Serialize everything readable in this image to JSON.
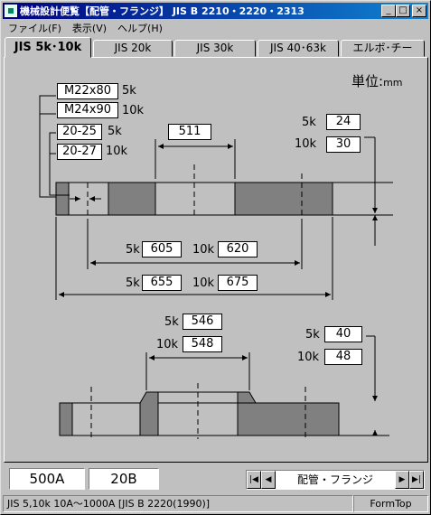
{
  "window": {
    "title": "機械設計便覧【配管・フランジ】 JIS B 2210・2220・2313",
    "min_glyph": "_",
    "max_glyph": "□",
    "close_glyph": "×"
  },
  "menu": [
    "ファイル(F)",
    "表示(V)",
    "ヘルプ(H)"
  ],
  "tabs": [
    {
      "label": "JIS 5k･10k",
      "active": true
    },
    {
      "label": "JIS 20k",
      "active": false
    },
    {
      "label": "JIS 30k",
      "active": false
    },
    {
      "label": "JIS 40･63k",
      "active": false
    },
    {
      "label": "エルボ･チー",
      "active": false
    }
  ],
  "unit": {
    "label": "単位:",
    "value": "mm"
  },
  "top_flange": {
    "bolts": [
      {
        "size": "M22x80",
        "class": "5k"
      },
      {
        "size": "M24x90",
        "class": "10k"
      }
    ],
    "holes": [
      {
        "size": "20-25",
        "class": "5k"
      },
      {
        "size": "20-27",
        "class": "10k"
      }
    ],
    "raised_face": "511",
    "thickness": [
      {
        "class": "5k",
        "value": "24"
      },
      {
        "class": "10k",
        "value": "30"
      }
    ],
    "pcd": [
      {
        "class": "5k",
        "value": "605"
      },
      {
        "class": "10k",
        "value": "620"
      }
    ],
    "outer_diameter": [
      {
        "class": "5k",
        "value": "655"
      },
      {
        "class": "10k",
        "value": "675"
      }
    ]
  },
  "bottom_flange": {
    "hub_diameter": [
      {
        "class": "5k",
        "value": "546"
      },
      {
        "class": "10k",
        "value": "548"
      }
    ],
    "thickness": [
      {
        "class": "5k",
        "value": "40"
      },
      {
        "class": "10k",
        "value": "48"
      }
    ]
  },
  "bottom": {
    "size_a": "500A",
    "size_b": "20B",
    "navigator_label": "配管・フランジ"
  },
  "status": {
    "left": "JIS 5,10k 10A～1000A [JIS B 2220(1990)]",
    "right": "FormTop"
  }
}
